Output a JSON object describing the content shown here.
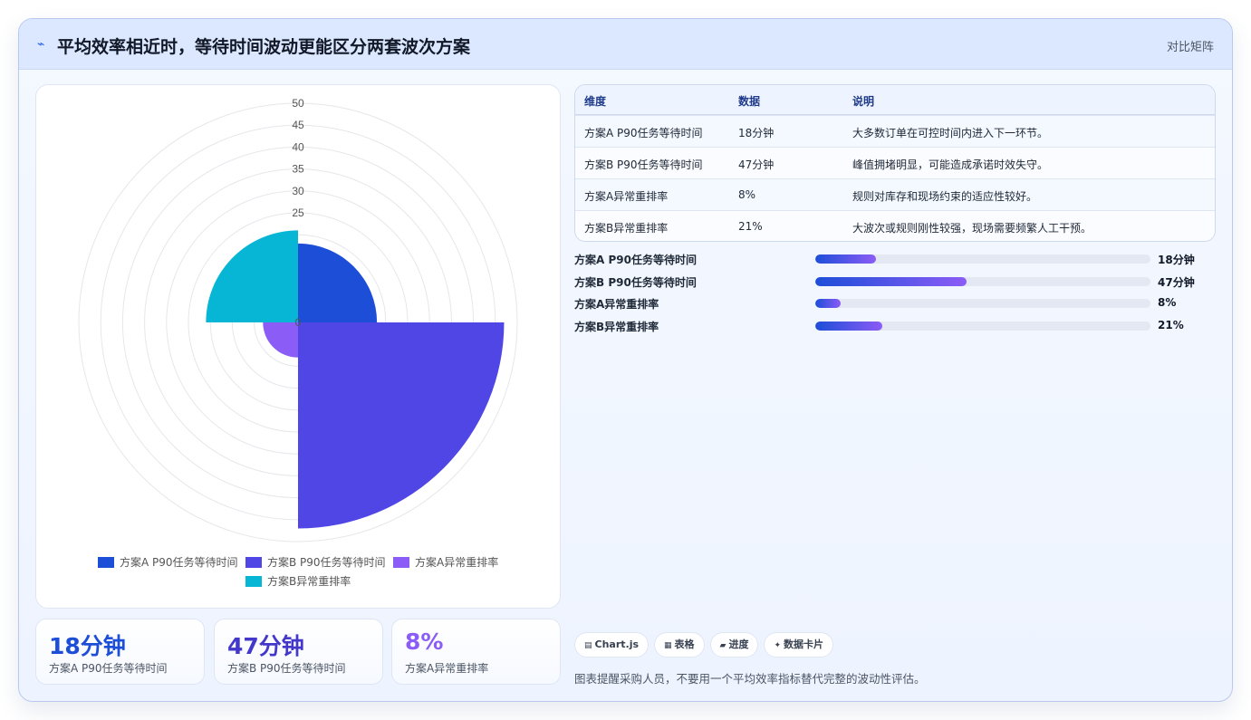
{
  "header": {
    "title": "平均效率相近时，等待时间波动更能区分两套波次方案",
    "title_icon": "lightning-icon",
    "tag": "对比矩阵"
  },
  "colors": {
    "series": [
      "#1d4ed8",
      "#4f46e5",
      "#8b5cf6",
      "#06b6d4"
    ],
    "kpi_values": [
      "#1d4ed8",
      "#4338ca",
      "#8b5cf6"
    ]
  },
  "chart_data": {
    "type": "polarArea",
    "categories": [
      "方案A P90任务等待时间",
      "方案B P90任务等待时间",
      "方案A异常重排率",
      "方案B异常重排率"
    ],
    "values": [
      18,
      47,
      8,
      21
    ],
    "r_ticks": [
      0,
      5,
      10,
      15,
      20,
      25,
      30,
      35,
      40,
      45,
      50
    ],
    "r_tick_labels_shown": [
      "50",
      "45",
      "40",
      "35",
      "30",
      "25",
      "0"
    ],
    "rlim": [
      0,
      50
    ],
    "legend_position": "bottom",
    "grid": true
  },
  "kpis": [
    {
      "value": "18分钟",
      "label": "方案A P90任务等待时间"
    },
    {
      "value": "47分钟",
      "label": "方案B P90任务等待时间"
    },
    {
      "value": "8%",
      "label": "方案A异常重排率"
    }
  ],
  "table": {
    "headers": [
      "维度",
      "数据",
      "说明"
    ],
    "rows": [
      [
        "方案A P90任务等待时间",
        "18分钟",
        "大多数订单在可控时间内进入下一环节。"
      ],
      [
        "方案B P90任务等待时间",
        "47分钟",
        "峰值拥堵明显，可能造成承诺时效失守。"
      ],
      [
        "方案A异常重排率",
        "8%",
        "规则对库存和现场约束的适应性较好。"
      ],
      [
        "方案B异常重排率",
        "21%",
        "大波次或规则刚性较强，现场需要频繁人工干预。"
      ]
    ]
  },
  "progress": [
    {
      "label": "方案A P90任务等待时间",
      "value_text": "18分钟",
      "fraction": 0.18
    },
    {
      "label": "方案B P90任务等待时间",
      "value_text": "47分钟",
      "fraction": 0.45
    },
    {
      "label": "方案A异常重排率",
      "value_text": "8%",
      "fraction": 0.075
    },
    {
      "label": "方案B异常重排率",
      "value_text": "21%",
      "fraction": 0.2
    }
  ],
  "chips": [
    {
      "icon": "chart-icon",
      "label": "Chart.js"
    },
    {
      "icon": "table-icon",
      "label": "表格"
    },
    {
      "icon": "folder-icon",
      "label": "进度"
    },
    {
      "icon": "sparkle-icon",
      "label": "数据卡片"
    }
  ],
  "footer_note": "图表提醒采购人员，不要用一个平均效率指标替代完整的波动性评估。"
}
